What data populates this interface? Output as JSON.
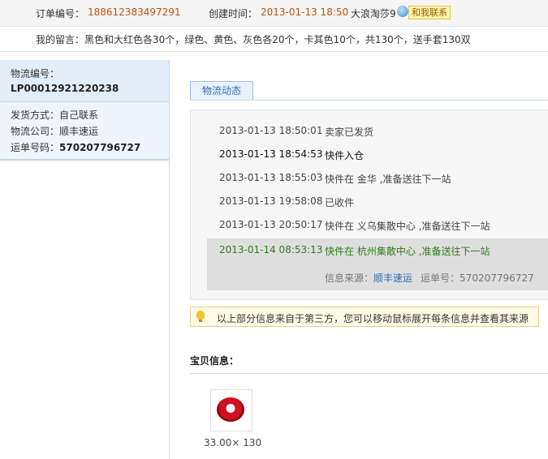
{
  "order": {
    "number_label": "订单编号：",
    "number": "188612383497291",
    "created_label": "创建时间：",
    "created": "2013-01-13 18:50",
    "seller": "大浪淘莎9",
    "contact_label": "和我联系"
  },
  "message": {
    "label": "我的留言：",
    "text": "黑色和大红色各30个，绿色、黄色、灰色各20个，卡其色10个，共130个，送手套130双"
  },
  "sidebar": {
    "tracking_label": "物流编号：",
    "tracking_number": "LP00012921220238",
    "ship_method": "发货方式：自己联系",
    "company": "物流公司：顺丰速运",
    "waybill_label": "运单号码：",
    "waybill": "570207796727"
  },
  "tab": {
    "label": "物流动态"
  },
  "events": [
    {
      "time": "2013-01-13 18:50:01",
      "desc": "卖家已发货"
    },
    {
      "time": "2013-01-13 18:54:53",
      "desc": "快件入仓"
    },
    {
      "time": "2013-01-13 18:55:03",
      "desc": "快件在 金华 ,准备送往下一站"
    },
    {
      "time": "2013-01-13 19:58:08",
      "desc": "已收件"
    },
    {
      "time": "2013-01-13 20:50:17",
      "desc": "快件在 义乌集散中心 ,准备送往下一站"
    },
    {
      "time": "2013-01-14 08:53:13",
      "desc": "快件在 杭州集散中心 ,准备送往下一站"
    }
  ],
  "source": {
    "label": "信息来源：",
    "company": "顺丰速运",
    "waybill_label": "运单号：",
    "waybill": "570207796727"
  },
  "notice": {
    "text": "以上部分信息来自于第三方，您可以移动鼠标展开每条信息并查看其来源"
  },
  "goods": {
    "title": "宝贝信息：",
    "price": "33.00× 130"
  },
  "colors": {
    "accent": "#2f6fb3",
    "current": "#2f7d1e",
    "order_number": "#c0510d"
  }
}
